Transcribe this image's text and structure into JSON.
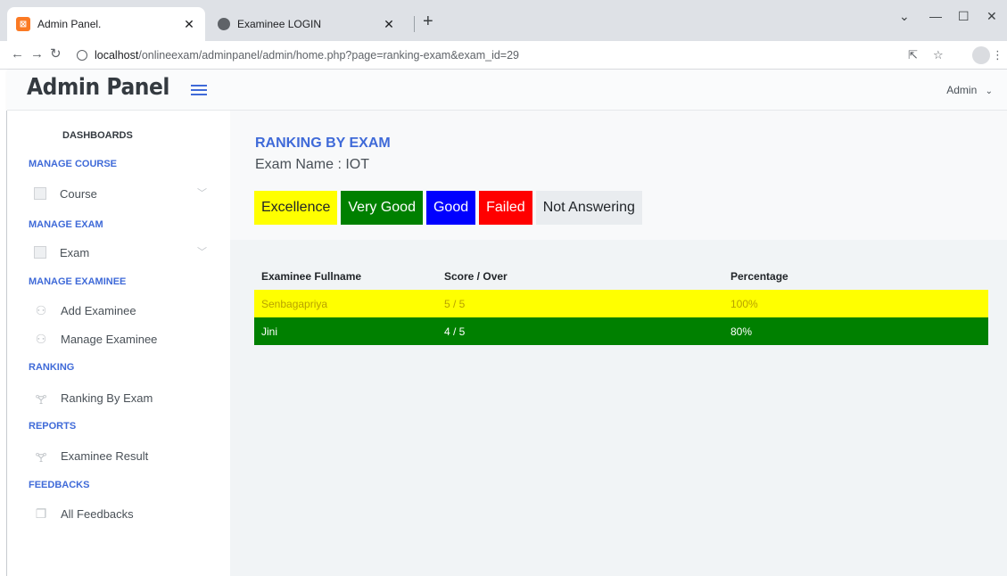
{
  "browser": {
    "tabs": [
      {
        "title": "Admin Panel.",
        "favicon": "xampp-icon"
      },
      {
        "title": "Examinee LOGIN",
        "favicon": "globe-icon"
      }
    ],
    "url_host": "localhost",
    "url_path": "/onlineexam/adminpanel/admin/home.php?page=ranking-exam&exam_id=29"
  },
  "header": {
    "brand": "Admin Panel",
    "user": "Admin"
  },
  "sidebar": {
    "dashboards": "DASHBOARDS",
    "manage_course": "MANAGE COURSE",
    "course": "Course",
    "manage_exam": "MANAGE EXAM",
    "exam": "Exam",
    "manage_examinee": "MANAGE EXAMINEE",
    "add_examinee": "Add Examinee",
    "manage_examinee_item": "Manage Examinee",
    "ranking": "RANKING",
    "ranking_by_exam": "Ranking By Exam",
    "reports": "REPORTS",
    "examinee_result": "Examinee Result",
    "feedbacks": "FEEDBACKS",
    "all_feedbacks": "All Feedbacks"
  },
  "main": {
    "title": "RANKING BY EXAM",
    "exam_label": "Exam Name : IOT",
    "legend": {
      "excellence": "Excellence",
      "very_good": "Very Good",
      "good": "Good",
      "failed": "Failed",
      "not_answering": "Not Answering"
    },
    "table": {
      "headers": [
        "Examinee Fullname",
        "Score / Over",
        "Percentage"
      ],
      "rows": [
        {
          "name": "Senbagapriya",
          "score": "5 / 5",
          "percentage": "100%",
          "rating": "excellence"
        },
        {
          "name": "Jini",
          "score": "4 / 5",
          "percentage": "80%",
          "rating": "very_good"
        }
      ]
    }
  },
  "colors": {
    "accent": "#3f6ad8",
    "excellence": "#ffff00",
    "very_good": "#008000",
    "good": "#0000ff",
    "failed": "#ff0000",
    "not_answering": "#e9ecef"
  }
}
